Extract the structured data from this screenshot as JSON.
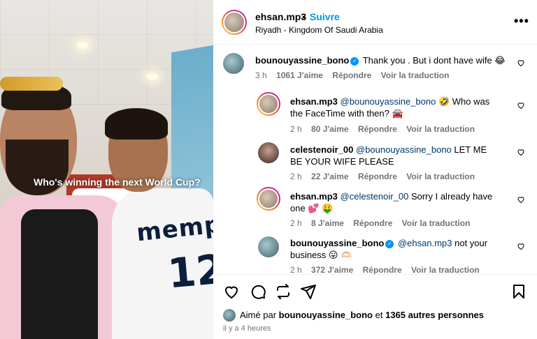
{
  "post": {
    "caption": "Who's winning the next World Cup?",
    "jersey_text": "memphis",
    "jersey_number": "12"
  },
  "header": {
    "username": "ehsan.mp3",
    "separator": "•",
    "follow_label": "Suivre",
    "location": "Riyadh - Kingdom Of Saudi Arabia",
    "more_icon": "more-horizontal-icon"
  },
  "comments": [
    {
      "username": "bounouyassine_bono",
      "verified": true,
      "text": "Thank you . But i dont have wife 😂",
      "time": "3 h",
      "likes": "1061 J'aime",
      "reply_label": "Répondre",
      "translate_label": "Voir la traduction"
    },
    {
      "username": "ehsan.mp3",
      "mention": "@bounouyassine_bono",
      "text": "🤣 Who was the FaceTime with then? 🚘",
      "time": "2 h",
      "likes": "80 J'aime",
      "reply_label": "Répondre",
      "translate_label": "Voir la traduction"
    },
    {
      "username": "celestenoir_00",
      "mention": "@bounouyassine_bono",
      "text": "LET ME BE YOUR WIFE PLEASE",
      "time": "2 h",
      "likes": "22 J'aime",
      "reply_label": "Répondre",
      "translate_label": "Voir la traduction"
    },
    {
      "username": "ehsan.mp3",
      "mention": "@celestenoir_00",
      "text": "Sorry I already have one 💕 🤑",
      "time": "2 h",
      "likes": "8 J'aime",
      "reply_label": "Répondre",
      "translate_label": "Voir la traduction"
    },
    {
      "username": "bounouyassine_bono",
      "verified": true,
      "mention": "@ehsan.mp3",
      "text": "not your business 😛 🫶🏻",
      "time": "2 h",
      "likes": "372 J'aime",
      "reply_label": "Répondre",
      "translate_label": "Voir la traduction"
    }
  ],
  "footer": {
    "liked_prefix": "Aimé par",
    "liked_user": "bounouyassine_bono",
    "liked_and": "et",
    "liked_others": "1365 autres personnes",
    "timestamp": "il y a 4 heures"
  },
  "colors": {
    "accent": "#0095f6",
    "mention": "#00376b",
    "meta": "#737373"
  }
}
